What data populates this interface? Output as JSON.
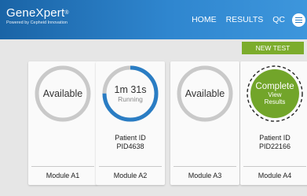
{
  "header": {
    "brand": "GeneXpert",
    "brand_mark": "®",
    "tagline": "Powered by Cepheid Innovation",
    "nav": [
      "HOME",
      "RESULTS",
      "QC"
    ],
    "menu_icon": "hamburger-menu-icon"
  },
  "actions": {
    "new_test": "NEW TEST"
  },
  "modules": [
    {
      "status": "Available",
      "substatus": "",
      "patient_label": "",
      "patient_id": "",
      "name": "Module A1",
      "progress": 0
    },
    {
      "status": "1m 31s",
      "substatus": "Running",
      "patient_label": "Patient ID",
      "patient_id": "PID4638",
      "name": "Module A2",
      "progress": 0.75
    },
    {
      "status": "Available",
      "substatus": "",
      "patient_label": "",
      "patient_id": "",
      "name": "Module A3",
      "progress": 0
    },
    {
      "status": "Complete",
      "substatus": "View",
      "substatus2": "Results",
      "patient_label": "Patient ID",
      "patient_id": "PID22166",
      "name": "Module A4",
      "progress": 1
    }
  ],
  "colors": {
    "header_start": "#1a64a6",
    "header_end": "#3d96dc",
    "accent_green": "#7cac2c",
    "ring_idle": "#c9c9c9",
    "ring_progress": "#2a7dc4",
    "complete_fill": "#72a52a"
  }
}
